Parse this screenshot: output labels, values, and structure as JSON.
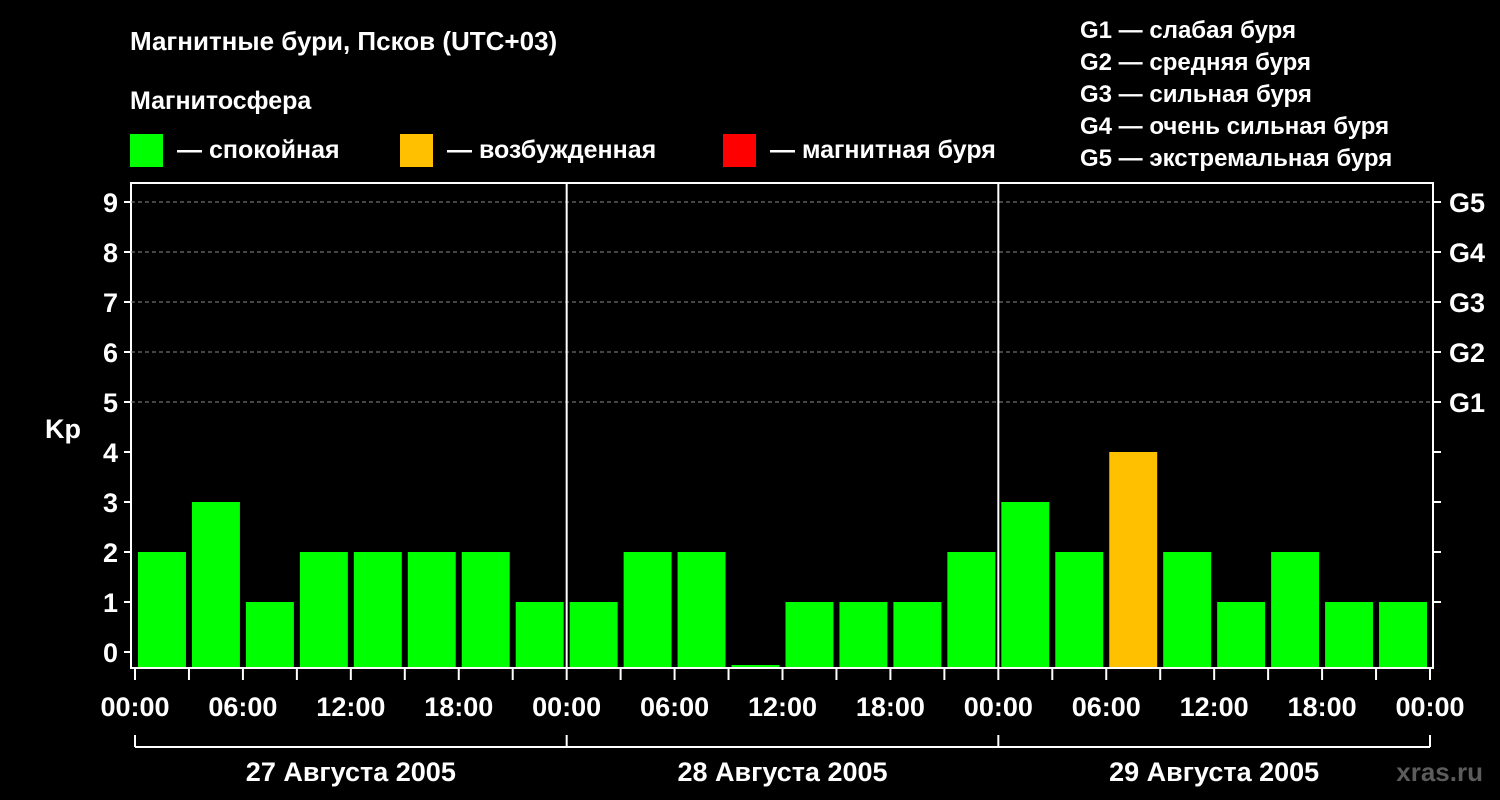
{
  "chart_data": {
    "type": "bar",
    "title": "Магнитные бури, Псков (UTC+03)",
    "legend_title": "Магнитосфера",
    "legend": [
      {
        "label": "— спокойная",
        "color": "#00ff00"
      },
      {
        "label": "— возбужденная",
        "color": "#ffc000"
      },
      {
        "label": "— магнитная буря",
        "color": "#ff0000"
      }
    ],
    "storm_scale": [
      "G1 — слабая буря",
      "G2 — средняя буря",
      "G3 — сильная буря",
      "G4 — очень сильная буря",
      "G5 — экстремальная буря"
    ],
    "ylabel": "Kp",
    "ylim": [
      0,
      9
    ],
    "yticks": [
      "0",
      "1",
      "2",
      "3",
      "4",
      "5",
      "6",
      "7",
      "8",
      "9"
    ],
    "right_ticks": [
      {
        "kp": 5,
        "label": "G1"
      },
      {
        "kp": 6,
        "label": "G2"
      },
      {
        "kp": 7,
        "label": "G3"
      },
      {
        "kp": 8,
        "label": "G4"
      },
      {
        "kp": 9,
        "label": "G5"
      }
    ],
    "grid": "dashed horizontal at Kp 5–9",
    "xtick_labels": [
      "00:00",
      "06:00",
      "12:00",
      "18:00",
      "00:00",
      "06:00",
      "12:00",
      "18:00",
      "00:00",
      "06:00",
      "12:00",
      "18:00",
      "00:00"
    ],
    "days": [
      "27 Августа 2005",
      "28 Августа 2005",
      "29 Августа 2005"
    ],
    "interval_hours": 3,
    "values": [
      2,
      3,
      1,
      2,
      2,
      2,
      2,
      1,
      1,
      2,
      2,
      0,
      1,
      1,
      1,
      2,
      3,
      2,
      4,
      2,
      1,
      2,
      1,
      1
    ],
    "status": [
      "спокойная",
      "спокойная",
      "спокойная",
      "спокойная",
      "спокойная",
      "спокойная",
      "спокойная",
      "спокойная",
      "спокойная",
      "спокойная",
      "спокойная",
      "спокойная",
      "спокойная",
      "спокойная",
      "спокойная",
      "спокойная",
      "спокойная",
      "спокойная",
      "возбужденная",
      "спокойная",
      "спокойная",
      "спокойная",
      "спокойная",
      "спокойная"
    ],
    "status_colors": {
      "спокойная": "#00ff00",
      "возбужденная": "#ffc000",
      "магнитная буря": "#ff0000"
    }
  },
  "watermark": "xras.ru"
}
